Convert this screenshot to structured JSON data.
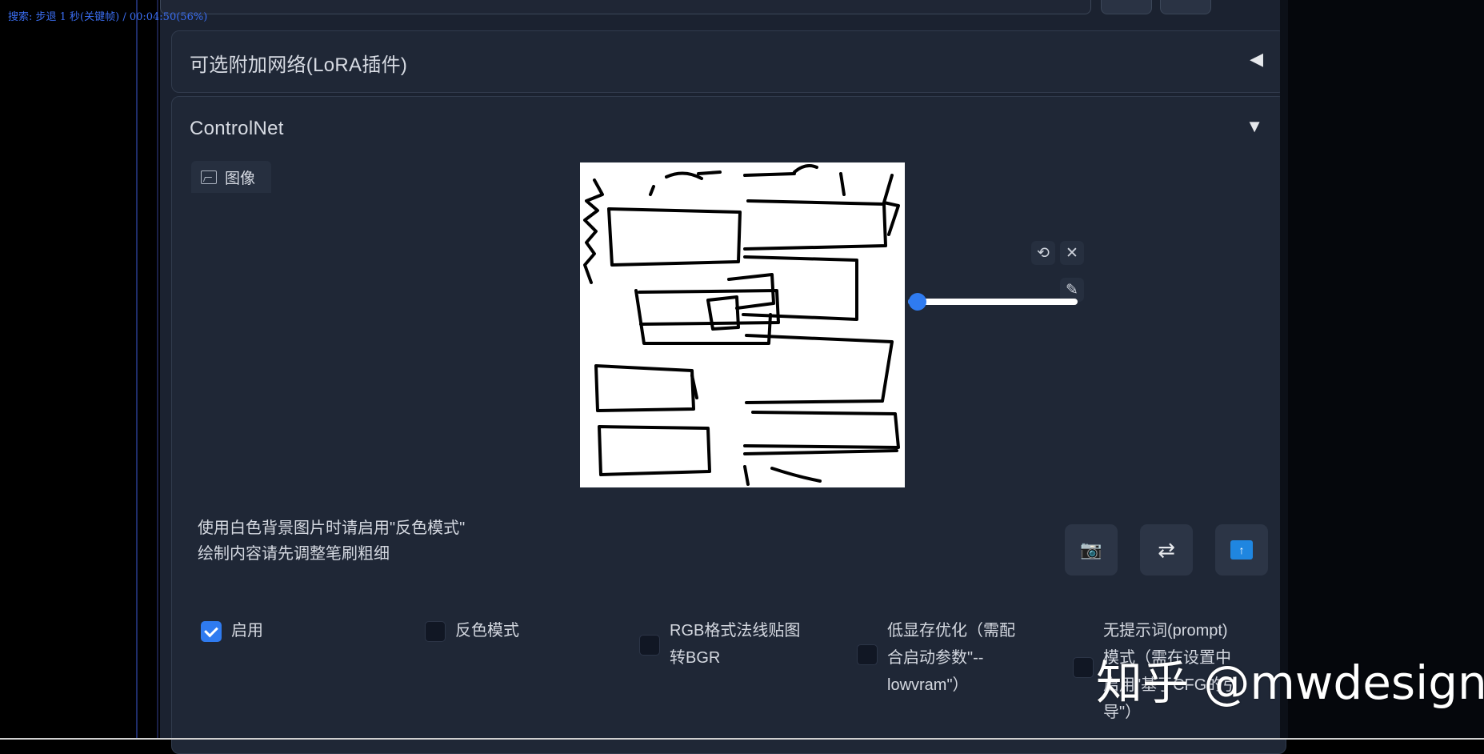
{
  "overlay": {
    "player_status": "搜索: 步退 1 秒(关键帧) / 00:04:50(56%)"
  },
  "lora": {
    "title": "可选附加网络(LoRA插件)",
    "arrow": "◀"
  },
  "controlnet": {
    "title": "ControlNet",
    "arrow": "▼",
    "image_tab_label": "图像",
    "undo_icon": "⟲",
    "close_icon": "✕",
    "brush_icon": "✎",
    "brush_size_fraction": 0.03,
    "hint_line1": "使用白色背景图片时请启用\"反色模式\"",
    "hint_line2": "绘制内容请先调整笔刷粗细",
    "actions": [
      {
        "icon": "camera-icon",
        "glyph": "📷"
      },
      {
        "icon": "swap-icon",
        "glyph": "⇄"
      },
      {
        "icon": "upload-icon",
        "glyph": "↑"
      }
    ],
    "options": [
      {
        "label": "启用",
        "checked": true
      },
      {
        "label": "反色模式",
        "checked": false
      },
      {
        "label": "RGB格式法线贴图\n转BGR",
        "checked": false
      },
      {
        "label": "低显存优化（需配\n合启动参数\"--\nlowvram\"）",
        "checked": false
      },
      {
        "label": "无提示词(prompt)\n模式（需在设置中\n启用\"基于CFG的引\n导\"）",
        "checked": false
      }
    ]
  },
  "watermark": {
    "text": "知乎 @mwdesign"
  },
  "colors": {
    "accent": "#2f7bf0",
    "panel_bg": "#1f2736",
    "app_bg": "#1b2230"
  }
}
